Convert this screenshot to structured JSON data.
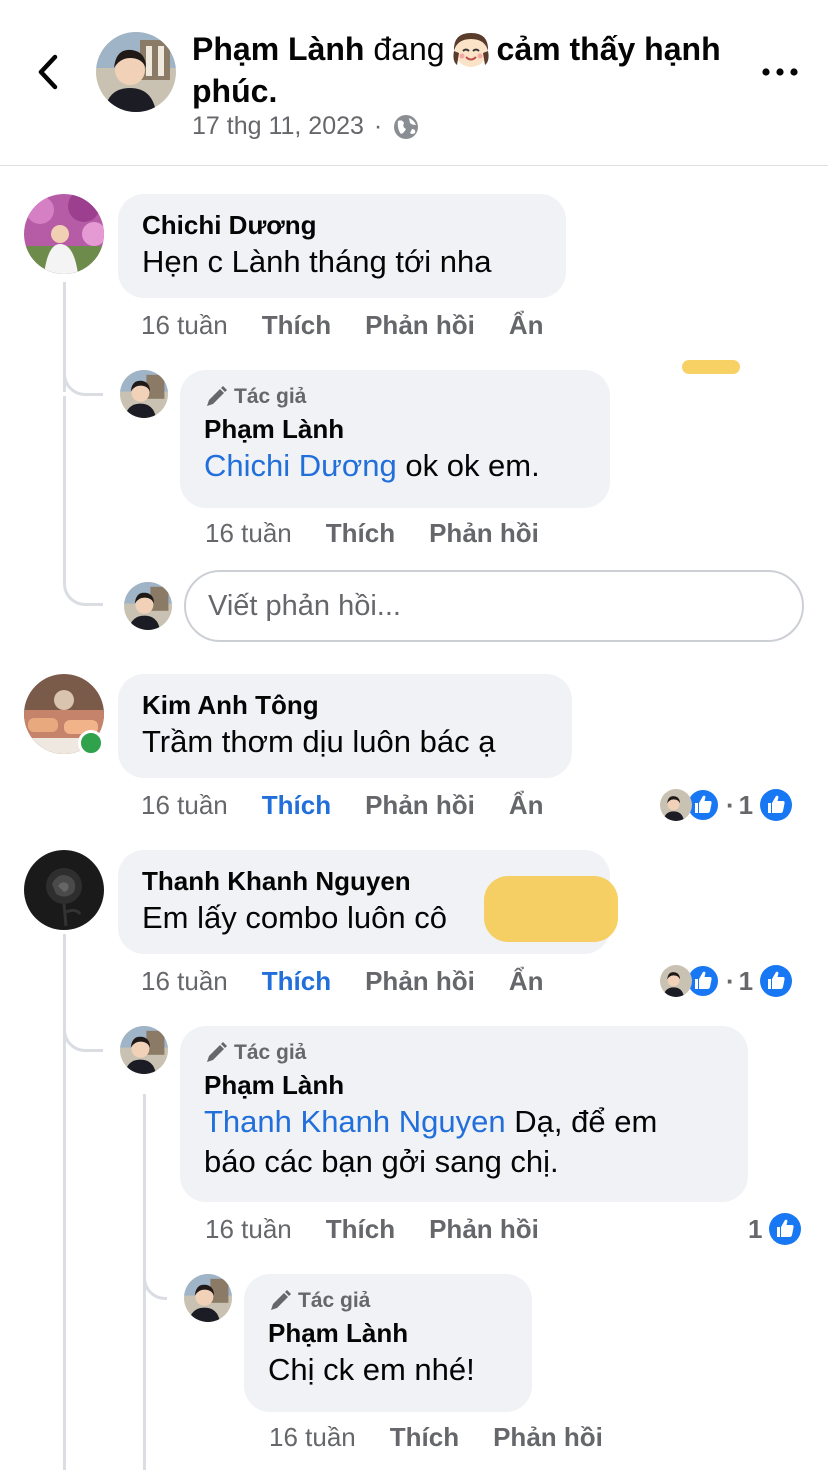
{
  "header": {
    "author": "Phạm Lành",
    "feeling_prefix": "đang",
    "feeling_text": "cảm thấy hạnh phúc.",
    "date": "17 thg 11, 2023",
    "separator": "·"
  },
  "labels": {
    "like": "Thích",
    "reply": "Phản hồi",
    "hide": "Ẩn",
    "author_badge": "Tác giả"
  },
  "comments": [
    {
      "author": "Chichi Dương",
      "text": "Hẹn c Lành tháng tới nha",
      "time": "16 tuần",
      "reply": {
        "author": "Phạm Lành",
        "mention": "Chichi Dương",
        "text": "ok ok em.",
        "time": "16 tuần"
      },
      "reply_input_placeholder": "Viết phản hồi..."
    },
    {
      "author": "Kim Anh Tông",
      "text": "Trầm thơm dịu luôn bác ạ",
      "time": "16 tuần",
      "like_count": "1"
    },
    {
      "author": "Thanh Khanh Nguyen",
      "text": "Em lấy combo luôn cô",
      "time": "16 tuần",
      "like_count": "1",
      "reply": {
        "author": "Phạm Lành",
        "mention": "Thanh Khanh Nguyen",
        "text": "Dạ, để em",
        "text2": "báo các bạn gởi sang chị.",
        "time": "16 tuần",
        "like_count": "1"
      },
      "reply2": {
        "author": "Phạm Lành",
        "text": "Chị ck em nhé!",
        "time": "16 tuần"
      }
    }
  ],
  "colors": {
    "accent": "#216fdb",
    "bubble": "#f0f2f5",
    "secondary_text": "#65676b",
    "online": "#31a24c",
    "like_icon": "#1877f2"
  },
  "icons": {
    "back": "chevron-left-icon",
    "more": "more-dots-icon",
    "privacy": "globe-icon",
    "author_badge": "pen-icon",
    "like_reaction": "thumbs-up-icon"
  }
}
